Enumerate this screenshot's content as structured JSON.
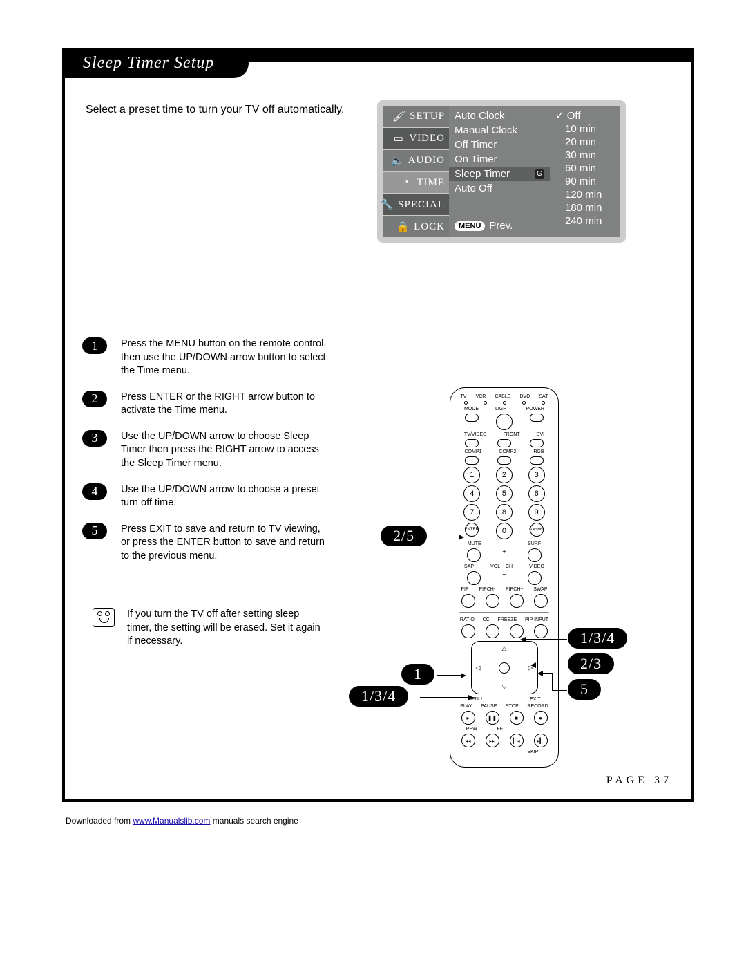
{
  "title": "Sleep Timer Setup",
  "intro": "Select a preset time to turn your TV off automatically.",
  "osd": {
    "sidebar": [
      "SETUP",
      "VIDEO",
      "AUDIO",
      "TIME",
      "SPECIAL",
      "LOCK"
    ],
    "middle": {
      "items": [
        "Auto Clock",
        "Manual Clock",
        "Off Timer",
        "On Timer"
      ],
      "selected": "Sleep Timer",
      "after": "Auto Off",
      "prev_btn": "MENU",
      "prev_text": "Prev."
    },
    "options": [
      "Off",
      "10 min",
      "20 min",
      "30 min",
      "60 min",
      "90 min",
      "120 min",
      "180 min",
      "240 min"
    ]
  },
  "steps": [
    "Press the MENU button on the remote control, then use the UP/DOWN arrow button to select the Time menu.",
    "Press ENTER or the RIGHT arrow button to activate the Time menu.",
    "Use the UP/DOWN arrow to choose Sleep Timer then press the RIGHT arrow to access the Sleep Timer menu.",
    "Use the UP/DOWN arrow to choose a preset turn off time.",
    "Press EXIT to save and return to TV viewing, or press the ENTER button to save and return to the previous menu."
  ],
  "note": "If you turn the TV off after setting sleep timer, the setting will be erased. Set it again if necessary.",
  "remote": {
    "top_labels": [
      "TV",
      "VCR",
      "CABLE",
      "DVD",
      "SAT"
    ],
    "row2": [
      "MODE",
      "LIGHT",
      "POWER"
    ],
    "row3": [
      "TV/VIDEO",
      "FRONT",
      "DVI"
    ],
    "row4": [
      "COMP1",
      "COMP2",
      "RGB"
    ],
    "nums": [
      "1",
      "2",
      "3",
      "4",
      "5",
      "6",
      "7",
      "8",
      "9",
      "0"
    ],
    "enter": "ENTER",
    "flashbk": "FLASHBK",
    "mute": "MUTE",
    "surf": "SURF",
    "sap": "SAP",
    "vol": "VOL",
    "ch": "CH",
    "video": "VIDEO",
    "pip_row": [
      "PIP",
      "PIPCH-",
      "PIPCH+",
      "SWAP"
    ],
    "mid_row": [
      "RATIO",
      "CC",
      "FREEZE",
      "PIP INPUT"
    ],
    "menu": "MENU",
    "exit": "EXIT",
    "transport_labels": [
      "PLAY",
      "PAUSE",
      "STOP",
      "RECORD"
    ],
    "rew": "REW",
    "ff": "FF",
    "skip": "SKIP"
  },
  "callouts": {
    "c25": "2/5",
    "c134_left": "1/3/4",
    "c1": "1",
    "c134_right": "1/3/4",
    "c23": "2/3",
    "c5": "5"
  },
  "page_num": "PAGE 37",
  "download": {
    "prefix": "Downloaded from ",
    "link_text": "www.Manualslib.com",
    "link_href": "#",
    "suffix": " manuals search engine"
  }
}
